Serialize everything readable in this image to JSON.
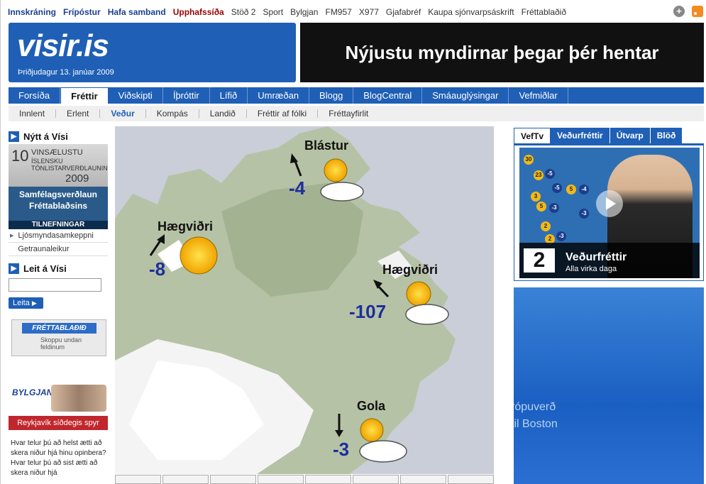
{
  "top_links": {
    "main": [
      "Innskráning",
      "Frípóstur",
      "Hafa samband"
    ],
    "red": "Upphafssíða",
    "plain": [
      "Stöð 2",
      "Sport",
      "Bylgjan",
      "FM957",
      "X977",
      "Gjafabréf",
      "Kaupa sjónvarpsáskrift",
      "Fréttablaðið"
    ]
  },
  "logo": {
    "text": "visir.is",
    "date": "Þriðjudagur 13. janúar 2009"
  },
  "banner": {
    "text": "Nýjustu myndirnar þegar þér hentar"
  },
  "nav": {
    "items": [
      "Forsíða",
      "Fréttir",
      "Viðskipti",
      "Íþróttir",
      "Lífið",
      "Umræðan",
      "Blogg",
      "BlogCentral",
      "Smáauglýsingar",
      "Vefmiðlar"
    ],
    "active": "Fréttir"
  },
  "subnav": {
    "items": [
      "Innlent",
      "Erlent",
      "Veður",
      "Kompás",
      "Landið",
      "Fréttir af fólki",
      "Fréttayfirlit"
    ],
    "active": "Veður"
  },
  "left": {
    "new_heading": "Nýtt á Vísi",
    "promo1": {
      "number": "10",
      "line1": "VINSÆLUSTU",
      "line2": "ÍSLENSKU",
      "line3": "TÓNLISTARVERÐLAUNIN",
      "year": "2009"
    },
    "promo2": {
      "line1": "Samfélagsverðlaun",
      "line2": "Fréttablaðsins",
      "footer": "TILNEFNINGAR"
    },
    "links": [
      "Ljósmyndasamkeppni",
      "Getraunaleikur"
    ],
    "search_heading": "Leit á Vísi",
    "search_button": "Leita",
    "frett_ad": {
      "header": "FRÉTTABLAÐIÐ",
      "sub": "Skoppu undan feldinum"
    },
    "bylgjan_ad": {
      "logo": "BYLGJAN",
      "bar": "Reykjavík síðdegis spyr"
    },
    "question": "Hvar telur þú að helst ætti að skera niður hjá hinu opinbera?Hvar telur þú að sist ætti að skera niður hjá"
  },
  "map": {
    "points": [
      {
        "label": "Blástur",
        "temp": "-4"
      },
      {
        "label": "Hægviðri",
        "temp": "-8"
      },
      {
        "label": "Hægviðri",
        "temp": "-107"
      },
      {
        "label": "Gola",
        "temp": "-3"
      }
    ]
  },
  "right": {
    "tabs": [
      "VefTv",
      "Veðurfréttir",
      "Útvarp",
      "Blöð"
    ],
    "active_tab": "VefTv",
    "video": {
      "channel": "2",
      "title": "Veðurfréttir",
      "subtitle": "Alla virka daga",
      "markers": [
        "30",
        "-5",
        "23",
        "-5",
        "5",
        "-4",
        "3",
        "5",
        "-3",
        "-3",
        "2",
        "-3",
        "2"
      ]
    },
    "ad": {
      "line1": "rópuverð",
      "line2": "til Boston"
    }
  },
  "colors": {
    "brand_blue": "#1f5fb5",
    "temp_blue": "#1c2f9a",
    "red_link": "#990000"
  }
}
